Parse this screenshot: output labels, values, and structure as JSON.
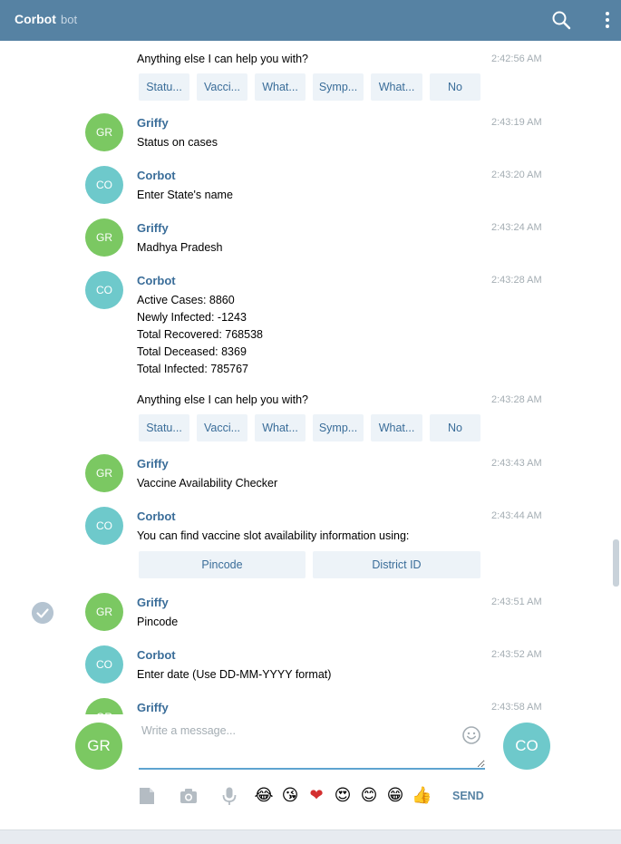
{
  "header": {
    "title": "Corbot",
    "subtitle": "bot"
  },
  "messages": [
    {
      "time": "2:42:56 AM",
      "text": [
        "Anything else I can help you with?"
      ]
    },
    {
      "sender": "Griffy",
      "initials": "GR",
      "time": "2:43:19 AM",
      "text": [
        "Status on cases"
      ]
    },
    {
      "sender": "Corbot",
      "initials": "CO",
      "time": "2:43:20 AM",
      "text": [
        "Enter State's name"
      ]
    },
    {
      "sender": "Griffy",
      "initials": "GR",
      "time": "2:43:24 AM",
      "text": [
        "Madhya Pradesh"
      ]
    },
    {
      "sender": "Corbot",
      "initials": "CO",
      "time": "2:43:28 AM",
      "text": [
        "Active Cases: 8860",
        "Newly Infected: -1243",
        "Total Recovered: 768538",
        "Total Deceased: 8369",
        "Total Infected: 785767"
      ]
    },
    {
      "time": "2:43:28 AM",
      "text": [
        "Anything else I can help you with?"
      ]
    },
    {
      "sender": "Griffy",
      "initials": "GR",
      "time": "2:43:43 AM",
      "text": [
        "Vaccine Availability Checker"
      ]
    },
    {
      "sender": "Corbot",
      "initials": "CO",
      "time": "2:43:44 AM",
      "text": [
        "You can find vaccine slot availability information using:"
      ]
    },
    {
      "sender": "Griffy",
      "initials": "GR",
      "time": "2:43:51 AM",
      "text": [
        "Pincode"
      ]
    },
    {
      "sender": "Corbot",
      "initials": "CO",
      "time": "2:43:52 AM",
      "text": [
        "Enter date (Use DD-MM-YYYY format)"
      ]
    },
    {
      "sender": "Griffy",
      "initials": "GR",
      "time": "2:43:58 AM",
      "text": []
    }
  ],
  "keyboards": {
    "menu_1": [
      "Statu...",
      "Vacci...",
      "What...",
      "Symp...",
      "What...",
      "No"
    ],
    "menu_2": [
      "Statu...",
      "Vacci...",
      "What...",
      "Symp...",
      "What...",
      "No"
    ],
    "vaccine": [
      "Pincode",
      "District ID"
    ]
  },
  "composer": {
    "placeholder": "Write a message...",
    "user_initials": "GR",
    "peer_initials": "CO",
    "send_label": "SEND",
    "emojis": [
      "😂",
      "😘",
      "❤",
      "😍",
      "😊",
      "😁",
      "👍"
    ]
  },
  "colors": {
    "header": "#5682a3",
    "link": "#3a6d99",
    "button_bg": "#edf3f8",
    "avatar_gr": "#7bc862",
    "avatar_co": "#6ec9cb"
  }
}
